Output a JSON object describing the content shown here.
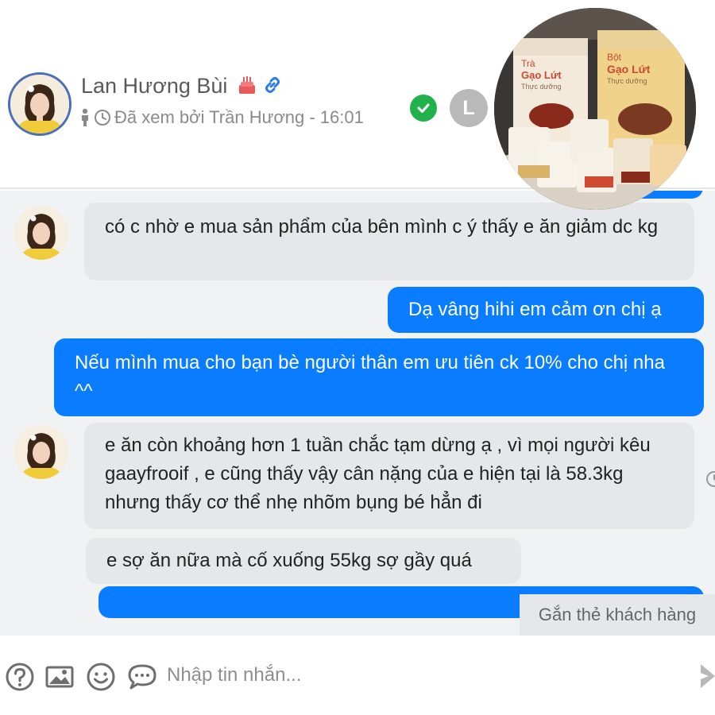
{
  "header": {
    "contact_name": "Lan Hương Bùi",
    "seen_text": "Đã xem bởi Trần Hương - 16:01",
    "badge_letter": "L"
  },
  "messages": [
    {
      "direction": "in",
      "text": "có c nhờ e mua sản phẩm của bên mình c ý thấy e ăn giảm dc kg"
    },
    {
      "direction": "out",
      "text": "Dạ vâng hihi em cảm ơn chị ạ"
    },
    {
      "direction": "out",
      "text": "Nếu mình mua cho bạn bè người thân em ưu tiên ck 10% cho chị nha ^^"
    },
    {
      "direction": "in",
      "text": "e ăn còn khoảng hơn 1 tuần chắc tạm dừng ạ , vì mọi người kêu gaayfrooif , e cũng thấy vậy cân nặng của e hiện tại là 58.3kg nhưng thấy cơ thể nhẹ nhõm bụng bé hẳn đi"
    },
    {
      "direction": "in",
      "text": "e sợ ăn nữa mà cố xuống 55kg sợ gầy quá"
    }
  ],
  "tag_button_label": "Gắn thẻ khách hàng",
  "input": {
    "placeholder": "Nhập tin nhắn..."
  },
  "product_photo": {
    "bag_left_text": [
      "Trà",
      "Gạo Lứt",
      "Thực dưỡng"
    ],
    "bag_right_text": [
      "Bột",
      "Gạo Lứt",
      "Thực dưỡng"
    ]
  },
  "icons": {
    "cake": "cake-icon",
    "link": "link-icon",
    "seen_person": "person-icon",
    "seen_clock": "clock-icon",
    "check": "check-icon",
    "help": "help-icon",
    "image": "image-icon",
    "emoji": "emoji-icon",
    "sticker": "chat-bubble-icon",
    "send": "send-icon"
  },
  "colors": {
    "outgoing_bubble": "#0a7cff",
    "incoming_bubble": "#e6e7ea",
    "chat_background": "#f1f2f4",
    "check_badge": "#22b24c",
    "cake_icon": "#e85a5a",
    "link_icon": "#2a7ee0",
    "avatar_ring": "#4a6fb5"
  }
}
